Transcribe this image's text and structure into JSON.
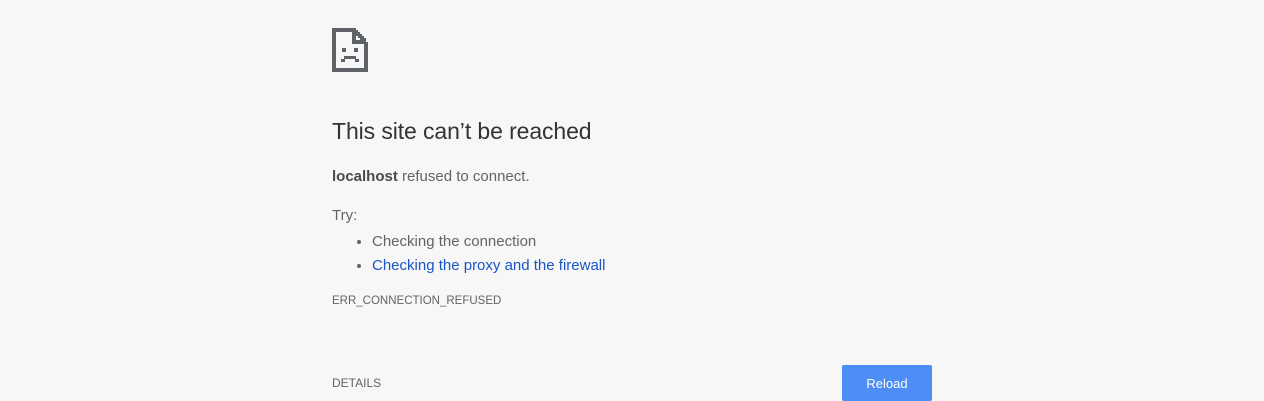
{
  "error_page": {
    "icon": "sad-document-icon",
    "heading": "This site can’t be reached",
    "summary": {
      "host": "localhost",
      "message": " refused to connect."
    },
    "try_label": "Try:",
    "suggestions": [
      {
        "label": "Checking the connection",
        "is_link": false
      },
      {
        "label": "Checking the proxy and the firewall",
        "is_link": true
      }
    ],
    "error_code": "ERR_CONNECTION_REFUSED",
    "details_label": "DETAILS",
    "reload_label": "Reload"
  },
  "colors": {
    "background": "#f7f7f7",
    "link": "#1a55c4",
    "button": "#4c8df6",
    "heading": "#333333",
    "text": "#646464"
  }
}
